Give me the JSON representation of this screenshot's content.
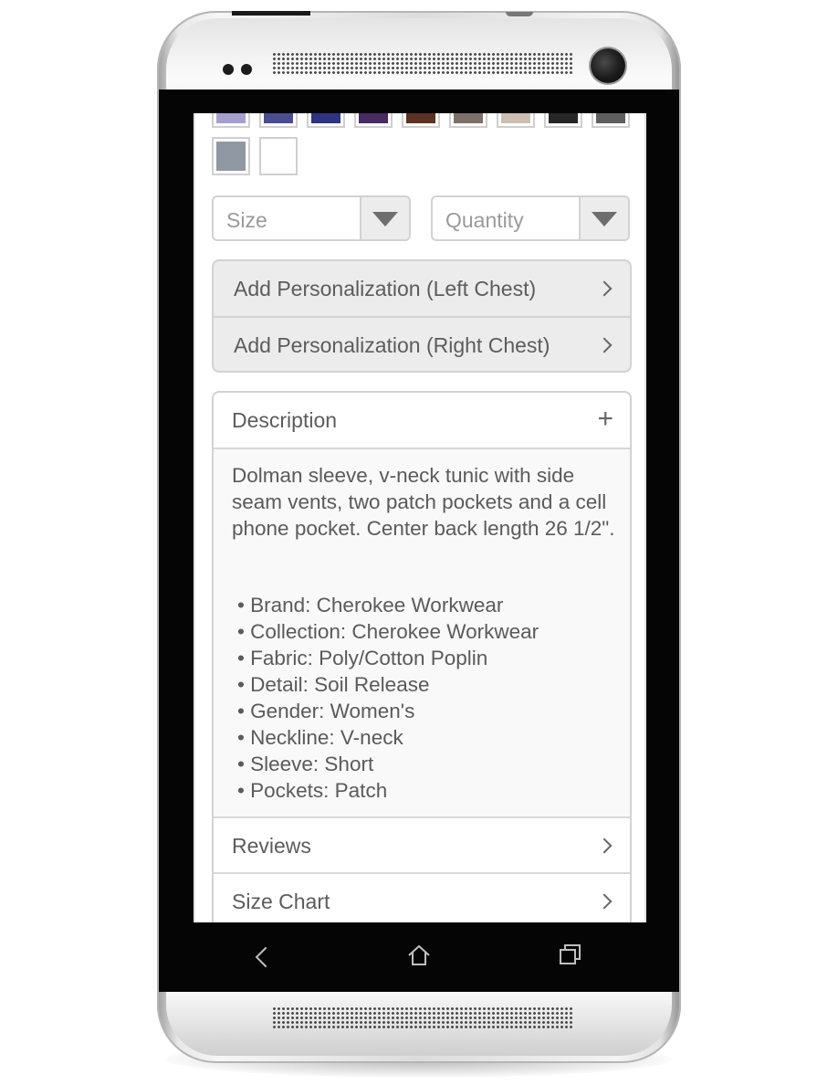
{
  "swatches": {
    "row1": [
      "#a59fd0",
      "#4a4d92",
      "#2e3583",
      "#472b62",
      "#5e3220",
      "#7d7068",
      "#cbbfb1",
      "#272727",
      "#5f5f5f"
    ],
    "row2": [
      "#8f98a3",
      "#ffffff"
    ]
  },
  "selects": {
    "size_label": "Size",
    "quantity_label": "Quantity"
  },
  "personalization": {
    "left_label": "Add Personalization (Left Chest)",
    "right_label": "Add Personalization (Right Chest)"
  },
  "description": {
    "title": "Description",
    "expand_symbol": "+",
    "text": "Dolman sleeve, v-neck tunic with side seam vents, two patch pockets  and a cell phone pocket. Center back length 26 1/2\".",
    "bullets": [
      "• Brand: Cherokee Workwear",
      "• Collection: Cherokee Workwear",
      "• Fabric: Poly/Cotton Poplin",
      "• Detail: Soil Release",
      "• Gender: Women's",
      "• Neckline: V-neck",
      "• Sleeve: Short",
      "• Pockets: Patch"
    ]
  },
  "sections": {
    "reviews_label": "Reviews",
    "size_chart_label": "Size Chart"
  },
  "nav": {
    "back_icon": "back-icon",
    "home_icon": "home-icon",
    "recent_icon": "recent-apps-icon"
  }
}
